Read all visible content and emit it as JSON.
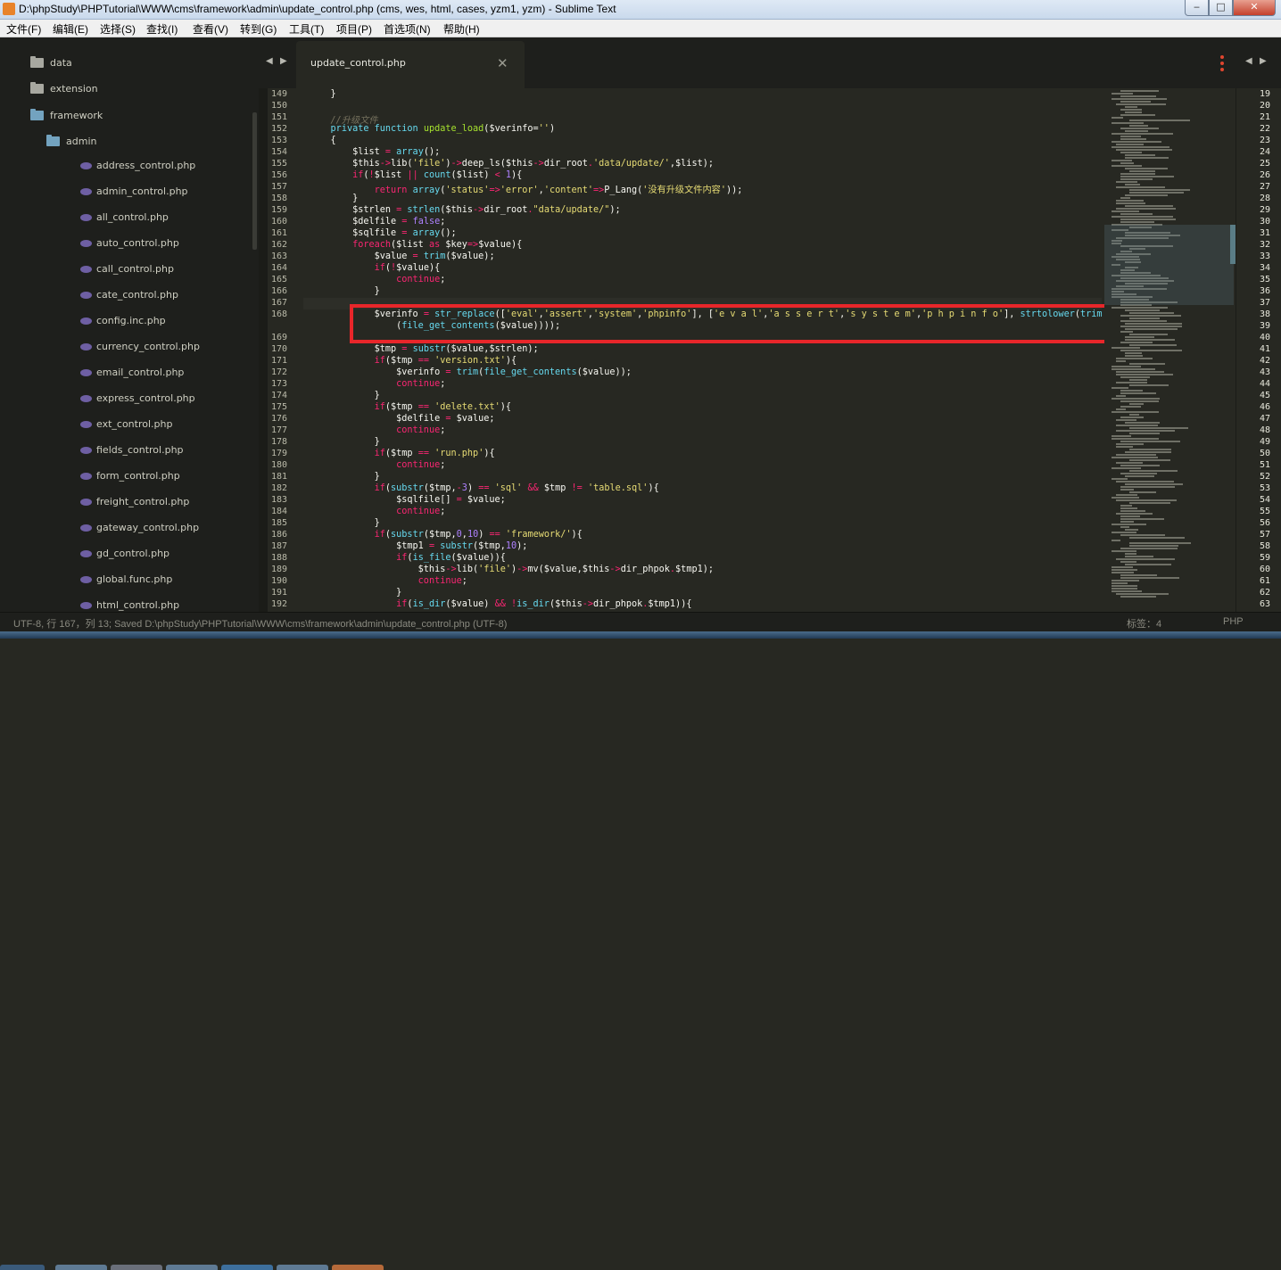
{
  "window": {
    "title": "D:\\phpStudy\\PHPTutorial\\WWW\\cms\\framework\\admin\\update_control.php (cms, wes, html, cases, yzm1, yzm) - Sublime Text",
    "minimize": "‒",
    "maximize": "□",
    "close": "✕"
  },
  "menu": [
    "文件(F)",
    "编辑(E)",
    "选择(S)",
    "查找(I)",
    "查看(V)",
    "转到(G)",
    "工具(T)",
    "项目(P)",
    "首选项(N)",
    "帮助(H)"
  ],
  "sidebar": {
    "folders": [
      {
        "label": "data",
        "icon": "folder-icon"
      },
      {
        "label": "extension",
        "icon": "folder-icon"
      },
      {
        "label": "framework",
        "icon": "folder-open-icon"
      },
      {
        "label": "admin",
        "icon": "folder-open-icon"
      }
    ],
    "files": [
      "address_control.php",
      "admin_control.php",
      "all_control.php",
      "auto_control.php",
      "call_control.php",
      "cate_control.php",
      "config.inc.php",
      "currency_control.php",
      "email_control.php",
      "express_control.php",
      "ext_control.php",
      "fields_control.php",
      "form_control.php",
      "freight_control.php",
      "gateway_control.php",
      "gd_control.php",
      "global.func.php",
      "html_control.php"
    ]
  },
  "tab": {
    "label": "update_control.php",
    "close_icon": "close-icon"
  },
  "editor": {
    "line_numbers": [
      "149",
      "150",
      "151",
      "152",
      "153",
      "154",
      "155",
      "156",
      "157",
      "158",
      "159",
      "160",
      "161",
      "162",
      "163",
      "164",
      "165",
      "166",
      "167",
      "168",
      "",
      "169",
      "170",
      "171",
      "172",
      "173",
      "174",
      "175",
      "176",
      "177",
      "178",
      "179",
      "180",
      "181",
      "182",
      "183",
      "184",
      "185",
      "186",
      "187",
      "188",
      "189",
      "190",
      "191",
      "192"
    ]
  },
  "right_pane": {
    "line_numbers": [
      "19",
      "20",
      "21",
      "22",
      "23",
      "24",
      "25",
      "26",
      "27",
      "28",
      "29",
      "30",
      "31",
      "32",
      "33",
      "34",
      "35",
      "36",
      "37",
      "38",
      "39",
      "40",
      "41",
      "42",
      "43",
      "44",
      "45",
      "46",
      "47",
      "48",
      "49",
      "50",
      "51",
      "52",
      "53",
      "54",
      "55",
      "56",
      "57",
      "58",
      "59",
      "60",
      "61",
      "62",
      "63"
    ]
  },
  "status": {
    "left": "UTF-8, 行 167，列 13; Saved D:\\phpStudy\\PHPTutorial\\WWW\\cms\\framework\\admin\\update_control.php (UTF-8)",
    "tab_size": "标签：4",
    "syntax": "PHP"
  },
  "colors": {
    "highlight_box": "#e8262a",
    "background": "#272822",
    "keyword": "#f92672",
    "string": "#e6db74",
    "function": "#66d9ef"
  }
}
